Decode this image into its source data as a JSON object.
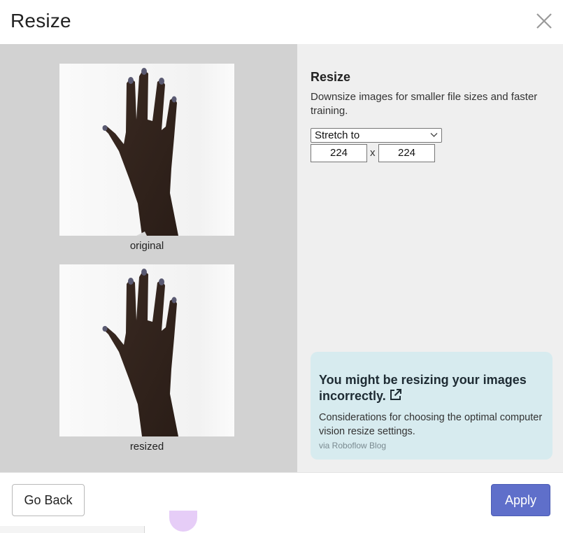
{
  "modal": {
    "title": "Resize"
  },
  "preview": {
    "original_caption": "original",
    "resized_caption": "resized"
  },
  "settings": {
    "title": "Resize",
    "description": "Downsize images for smaller file sizes and faster training.",
    "mode": {
      "selected": "Stretch to"
    },
    "width": "224",
    "height": "224",
    "separator": "x"
  },
  "info": {
    "title": "You might be resizing your images incorrectly.",
    "description": "Considerations for choosing the optimal computer vision resize settings.",
    "source": "via Roboflow Blog",
    "icon": "external-link-icon"
  },
  "footer": {
    "back_label": "Go Back",
    "apply_label": "Apply"
  },
  "colors": {
    "accent": "#5f6fca",
    "info_bg": "#d7ebef",
    "preview_bg": "#d2d2d2",
    "panel_bg": "#efefef"
  }
}
